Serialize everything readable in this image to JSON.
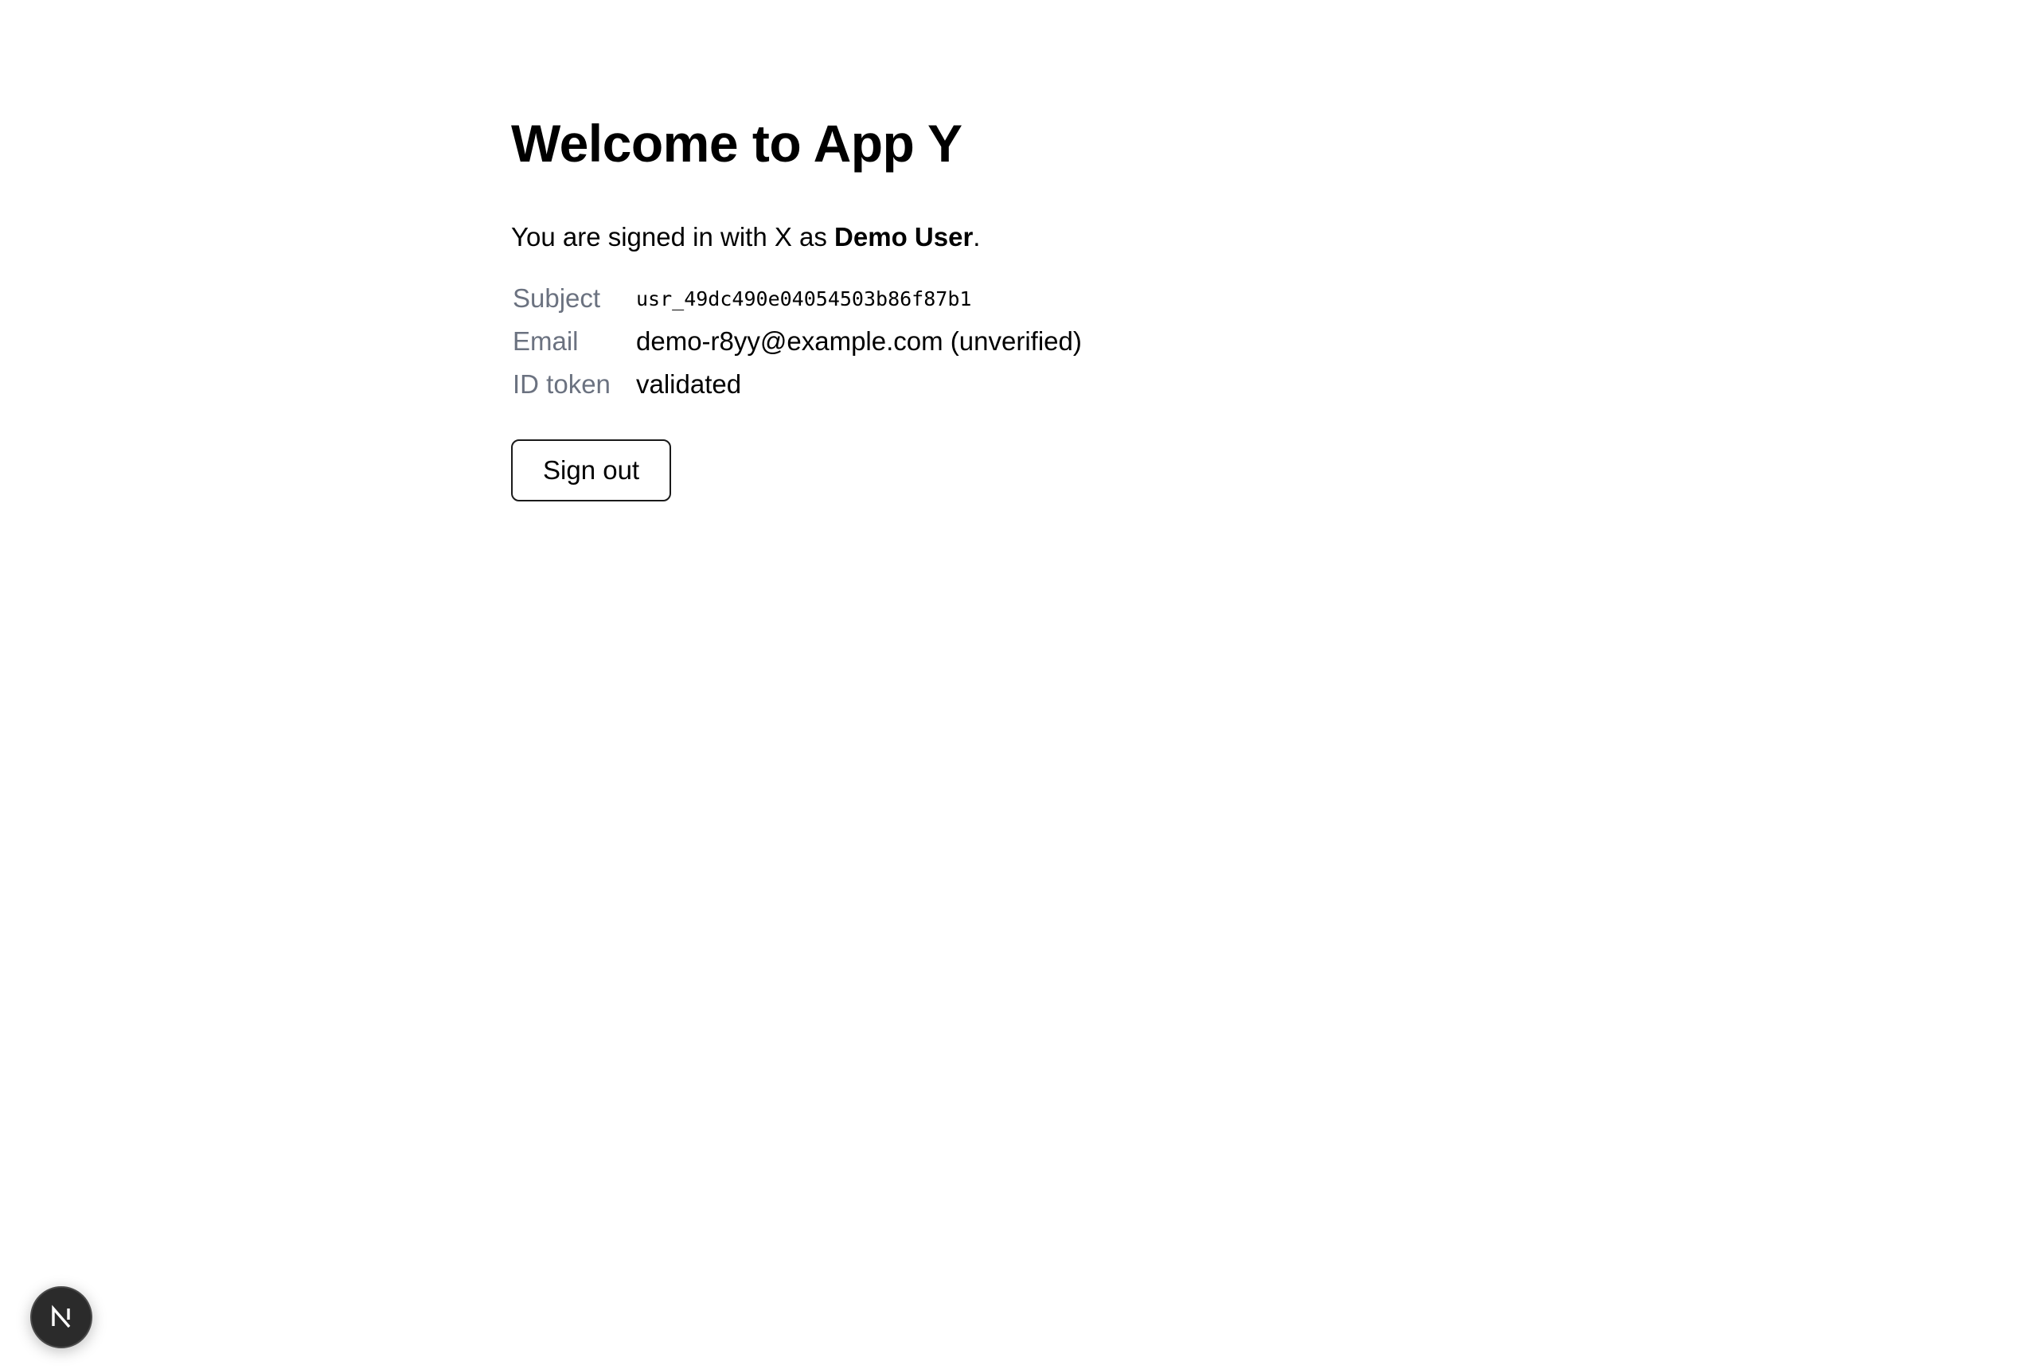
{
  "main": {
    "title": "Welcome to App Y",
    "intro": {
      "prefix": "You are signed in with X as ",
      "user_name": "Demo User",
      "suffix": "."
    },
    "details": [
      {
        "label": "Subject",
        "value": "usr_49dc490e04054503b86f87b1"
      },
      {
        "label": "Email",
        "value": "demo-r8yy@example.com (unverified)"
      },
      {
        "label": "ID token",
        "value": "validated"
      }
    ],
    "signout_label": "Sign out"
  },
  "dev_badge": {
    "icon": "nextjs-logo-icon",
    "colors": {
      "background": "#2b2b2b",
      "foreground": "#ffffff"
    }
  }
}
